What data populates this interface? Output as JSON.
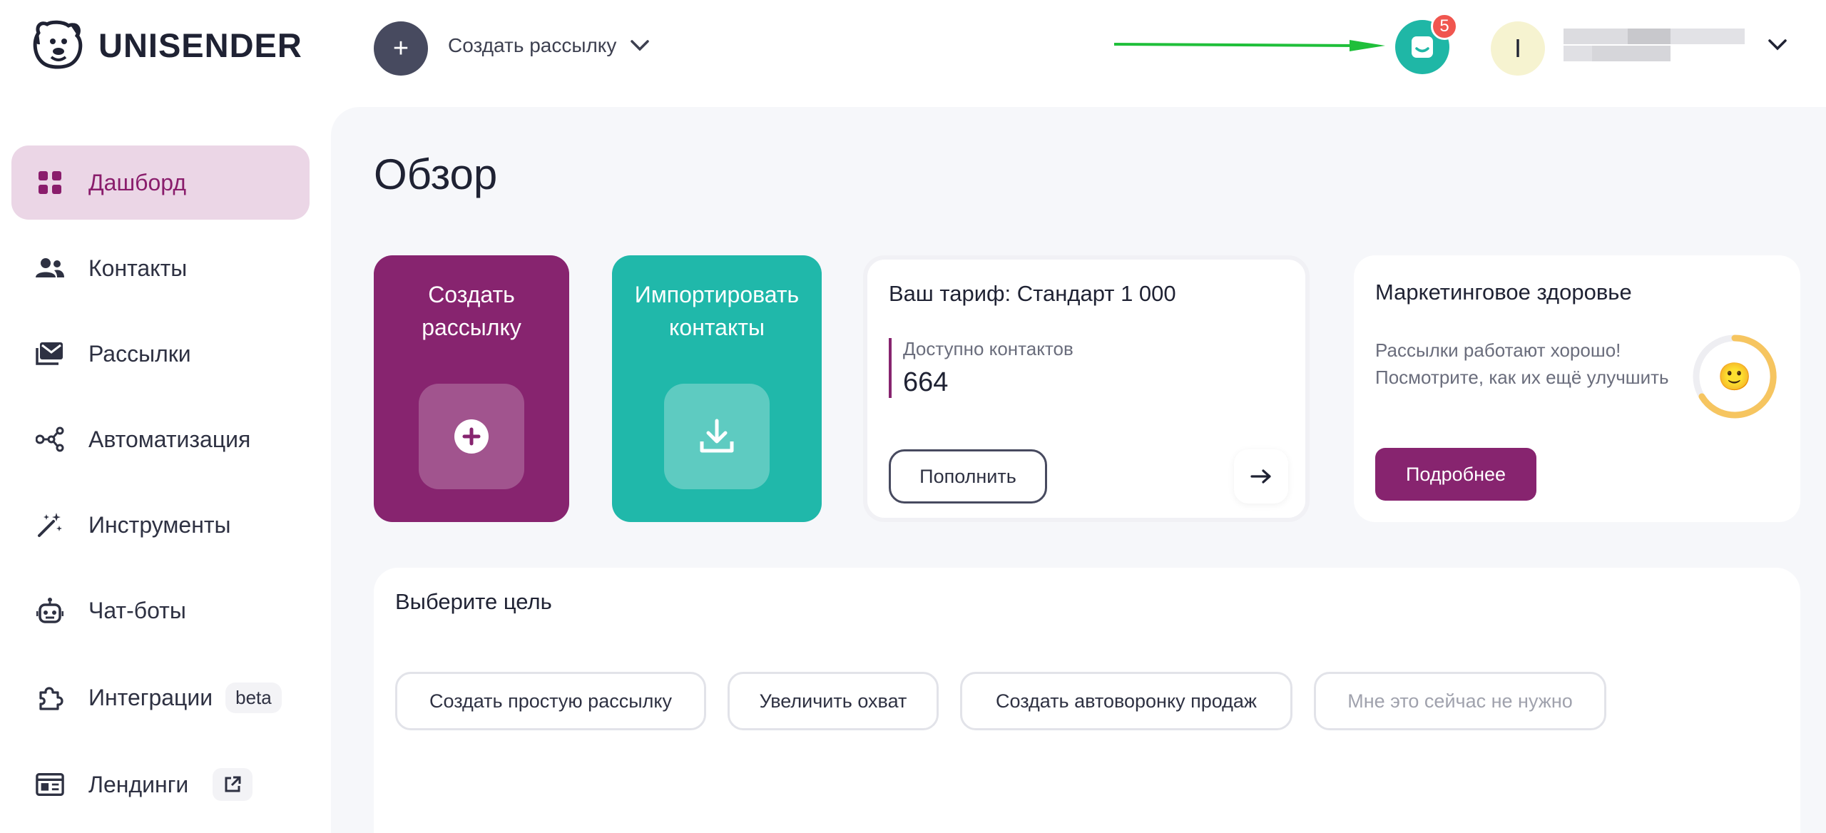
{
  "header": {
    "brand": "UNISENDER",
    "create_label": "Создать рассылку",
    "notifications_count": "5",
    "user_initial": "I"
  },
  "sidebar": {
    "items": [
      {
        "label": "Дашборд",
        "icon": "grid-icon",
        "active": true
      },
      {
        "label": "Контакты",
        "icon": "people-icon"
      },
      {
        "label": "Рассылки",
        "icon": "mail-icon"
      },
      {
        "label": "Автоматизация",
        "icon": "flow-icon"
      },
      {
        "label": "Инструменты",
        "icon": "magic-wand-icon"
      },
      {
        "label": "Чат-боты",
        "icon": "bot-icon"
      },
      {
        "label": "Интеграции",
        "icon": "puzzle-icon",
        "badge": "beta"
      },
      {
        "label": "Лендинги",
        "icon": "landing-icon",
        "external": true
      }
    ]
  },
  "main": {
    "title": "Обзор",
    "create_card": {
      "line1": "Создать",
      "line2": "рассылку"
    },
    "import_card": {
      "line1": "Импортировать",
      "line2": "контакты"
    },
    "tariff": {
      "title": "Ваш тариф: Стандарт 1 000",
      "label": "Доступно контактов",
      "value": "664",
      "button": "Пополнить"
    },
    "health": {
      "title": "Маркетинговое здоровье",
      "text": "Рассылки работают хорошо! Посмотрите, как их ещё улучшить",
      "button": "Подробнее",
      "emoji": "🙂"
    },
    "goal": {
      "title": "Выберите цель",
      "options": [
        "Создать простую рассылку",
        "Увеличить охват",
        "Создать автоворонку продаж",
        "Мне это сейчас не нужно"
      ]
    }
  },
  "colors": {
    "brand_purple": "#87246f",
    "teal": "#20b8aa",
    "active_bg": "#ebd6e6",
    "badge_red": "#f0564f",
    "annotation_arrow": "#1fbf3a"
  }
}
